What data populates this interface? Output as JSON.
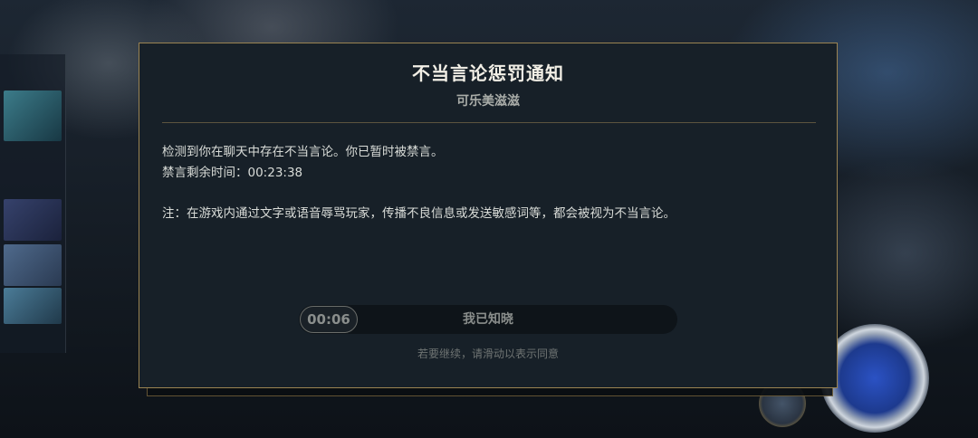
{
  "notice": {
    "title": "不当言论惩罚通知",
    "player_name": "可乐美滋滋",
    "message_line_1": "检测到你在聊天中存在不当言论。你已暂时被禁言。",
    "message_line_2": "禁言剩余时间：00:23:38",
    "note": "注：在游戏内通过文字或语音辱骂玩家，传播不良信息或发送敏感词等，都会被视为不当言论。"
  },
  "confirm_slider": {
    "countdown": "00:06",
    "label": "我已知晓",
    "hint": "若要继续，请滑动以表示同意"
  },
  "colors": {
    "border_gold": "#9b8452",
    "panel_bg": "#172028"
  }
}
